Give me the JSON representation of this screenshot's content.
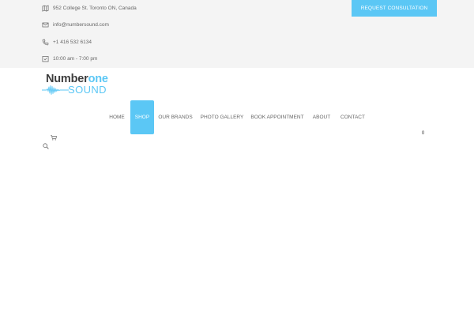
{
  "topbar": {
    "address": "952 College St. Toronto ON, Canada",
    "email": "info@numbersound.com",
    "phone": "+1 416 532 6134",
    "hours": "10:00 am - 7:00 pm",
    "cta_label": "REQUEST CONSULTATION",
    "icons": [
      "map-icon",
      "mail-icon",
      "phone-icon",
      "calendar-icon"
    ]
  },
  "logo": {
    "word1": "Number",
    "word2": "one",
    "word3": "SOUND"
  },
  "nav": {
    "items": [
      {
        "label": "HOME"
      },
      {
        "label": "SHOP",
        "active": true
      },
      {
        "label": "OUR BRANDS"
      },
      {
        "label": "PHOTO GALLERY"
      },
      {
        "label": "BOOK APPOINTMENT"
      },
      {
        "label": "ABOUT"
      },
      {
        "label": "CONTACT"
      }
    ]
  },
  "cart": {
    "count": "0",
    "icon": "cart-icon"
  },
  "search": {
    "icon": "search-icon"
  },
  "colors": {
    "accent": "#5bc7f5",
    "topbar_bg": "#f4f4f4",
    "logo_dark": "#3d3d3d"
  }
}
